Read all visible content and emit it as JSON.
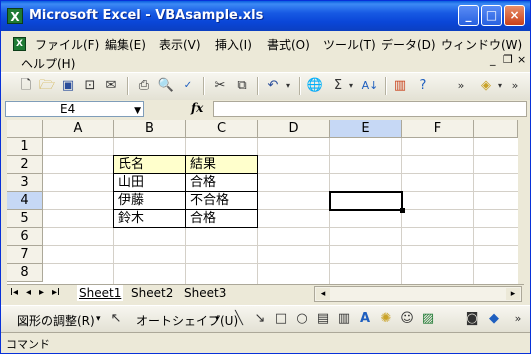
{
  "window": {
    "title": "Microsoft Excel - VBAsample.xls",
    "minimize": "_",
    "maximize": "□",
    "close": "×"
  },
  "menu": {
    "items": [
      "ファイル(F)",
      "編集(E)",
      "表示(V)",
      "挿入(I)",
      "書式(O)",
      "ツール(T)",
      "データ(D)",
      "ウィンドウ(W)",
      "ヘルプ(H)"
    ],
    "doc_minimize": "_",
    "doc_restore": "❐",
    "doc_close": "×"
  },
  "formula_bar": {
    "name_box": "E4",
    "fx": "fx",
    "formula": ""
  },
  "grid": {
    "columns": [
      "A",
      "B",
      "C",
      "D",
      "E",
      "F"
    ],
    "rows": [
      "1",
      "2",
      "3",
      "4",
      "5",
      "6",
      "7",
      "8"
    ],
    "selected_column": "E",
    "selected_row": "4",
    "active_cell": "E4",
    "cells": {
      "B2": "氏名",
      "C2": "結果",
      "B3": "山田",
      "C3": "合格",
      "B4": "伊藤",
      "C4": "不合格",
      "B5": "鈴木",
      "C5": "合格"
    },
    "header_fill_color": "#ffffcc"
  },
  "sheets": {
    "tabs": [
      "Sheet1",
      "Sheet2",
      "Sheet3"
    ],
    "active": "Sheet1"
  },
  "drawing_toolbar": {
    "draw_label": "図形の調整(R)",
    "autoshape_label": "オートシェイプ(U)"
  },
  "status": {
    "text": "コマンド"
  }
}
